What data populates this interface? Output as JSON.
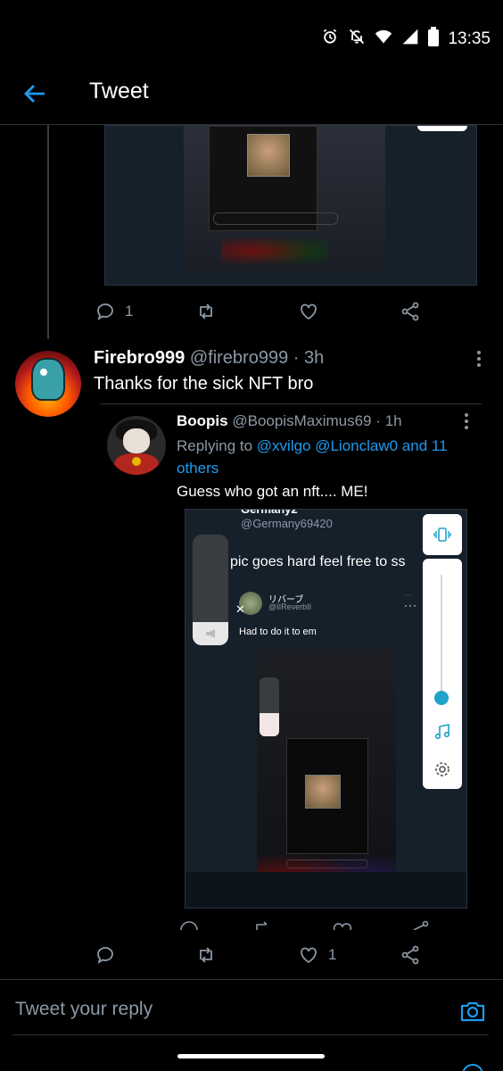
{
  "status_bar": {
    "time": "13:35"
  },
  "header": {
    "title": "Tweet"
  },
  "parent_tweet_actions": {
    "reply_count": "1",
    "retweet_count": "",
    "like_count": ""
  },
  "reply_tweet": {
    "name": "Firebro999",
    "handle": "@firebro999",
    "time": "· 3h",
    "text": "Thanks for the sick NFT bro"
  },
  "quoted_tweet": {
    "name": "Boopis",
    "handle": "@BoopisMaximus69",
    "time": "· 1h",
    "replying_prefix": "Replying to ",
    "mentions": "@xvilgo @Lionclaw0 and 11 others",
    "text": "Guess who got an nft.... ME!",
    "media": {
      "name_partial": "Germany2",
      "handle": "@Germany69420",
      "snippet": "pic goes hard feel free to ss",
      "inner_name": "リバーブ",
      "inner_handle": "@IIReverbII",
      "inner_dots": "···",
      "inner_text": "Had to do it to em"
    }
  },
  "reply_tweet_actions": {
    "reply_count": "",
    "retweet_count": "",
    "like_count": "1"
  },
  "composer": {
    "placeholder": "Tweet your reply"
  },
  "colors": {
    "accent": "#1d9bf0",
    "background": "#000000",
    "muted": "#8b98a5",
    "panel_accent": "#1fa3c9"
  }
}
